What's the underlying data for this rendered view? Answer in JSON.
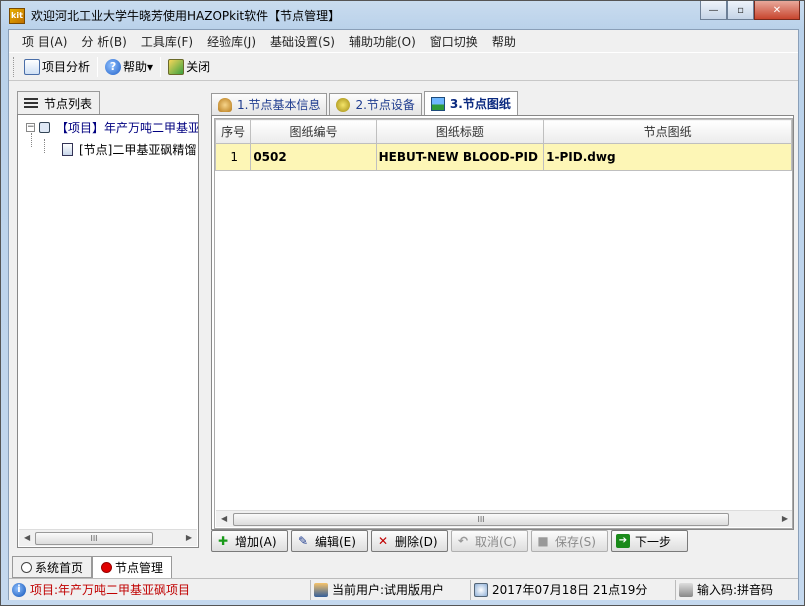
{
  "window": {
    "title": "欢迎河北工业大学牛晓芳使用HAZOPkit软件【节点管理】",
    "icon_text": "kit",
    "controls": {
      "minimize": "—",
      "maximize": "▫",
      "close": "✕"
    }
  },
  "menu": [
    "项 目(A)",
    "分 析(B)",
    "工具库(F)",
    "经验库(J)",
    "基础设置(S)",
    "辅助功能(O)",
    "窗口切换",
    "帮助"
  ],
  "toolbar": {
    "analysis_label": "项目分析",
    "help_label": "帮助",
    "help_arrow": "▾",
    "close_label": "关闭"
  },
  "left_panel": {
    "tab_label": "节点列表",
    "tree": {
      "root_expander": "−",
      "root_label": "【项目】年产万吨二甲基亚砜精馏项目",
      "child_label": "[节点]二甲基亚砜精馏"
    },
    "scrollbar": {
      "left": "◀",
      "right": "▶",
      "thumb": "III"
    }
  },
  "tabs": [
    {
      "label": "1.节点基本信息",
      "icon": "hand-icon"
    },
    {
      "label": "2.节点设备",
      "icon": "equipment-icon"
    },
    {
      "label": "3.节点图纸",
      "icon": "image-icon"
    }
  ],
  "grid": {
    "columns": [
      "序号",
      "图纸编号",
      "图纸标题",
      "节点图纸"
    ],
    "rows": [
      {
        "index": "1",
        "number": "0502",
        "title": "HEBUT-NEW BLOOD-PID",
        "file": "1-PID.dwg"
      }
    ],
    "scrollbar": {
      "left": "◀",
      "right": "▶",
      "thumb": "III"
    }
  },
  "actions": [
    {
      "label": "增加(A)",
      "icon": "✚",
      "color": "#1a9a1a",
      "enabled": true
    },
    {
      "label": "编辑(E)",
      "icon": "✎",
      "color": "#1f3c8f",
      "enabled": true
    },
    {
      "label": "删除(D)",
      "icon": "✕",
      "color": "#c00000",
      "enabled": true
    },
    {
      "label": "取消(C)",
      "icon": "↶",
      "color": "#999999",
      "enabled": false
    },
    {
      "label": "保存(S)",
      "icon": "■",
      "color": "#999999",
      "enabled": false
    },
    {
      "label": "下一步",
      "icon": "➔",
      "color": "#1a8a1a",
      "enabled": true
    }
  ],
  "bottom_tabs": [
    {
      "label": "系统首页",
      "active": false
    },
    {
      "label": "节点管理",
      "active": true
    }
  ],
  "status": {
    "project": "项目:年产万吨二甲基亚砜项目",
    "user": "当前用户:试用版用户",
    "datetime": "2017年07月18日  21点19分",
    "input_method": "输入码:拼音码"
  }
}
